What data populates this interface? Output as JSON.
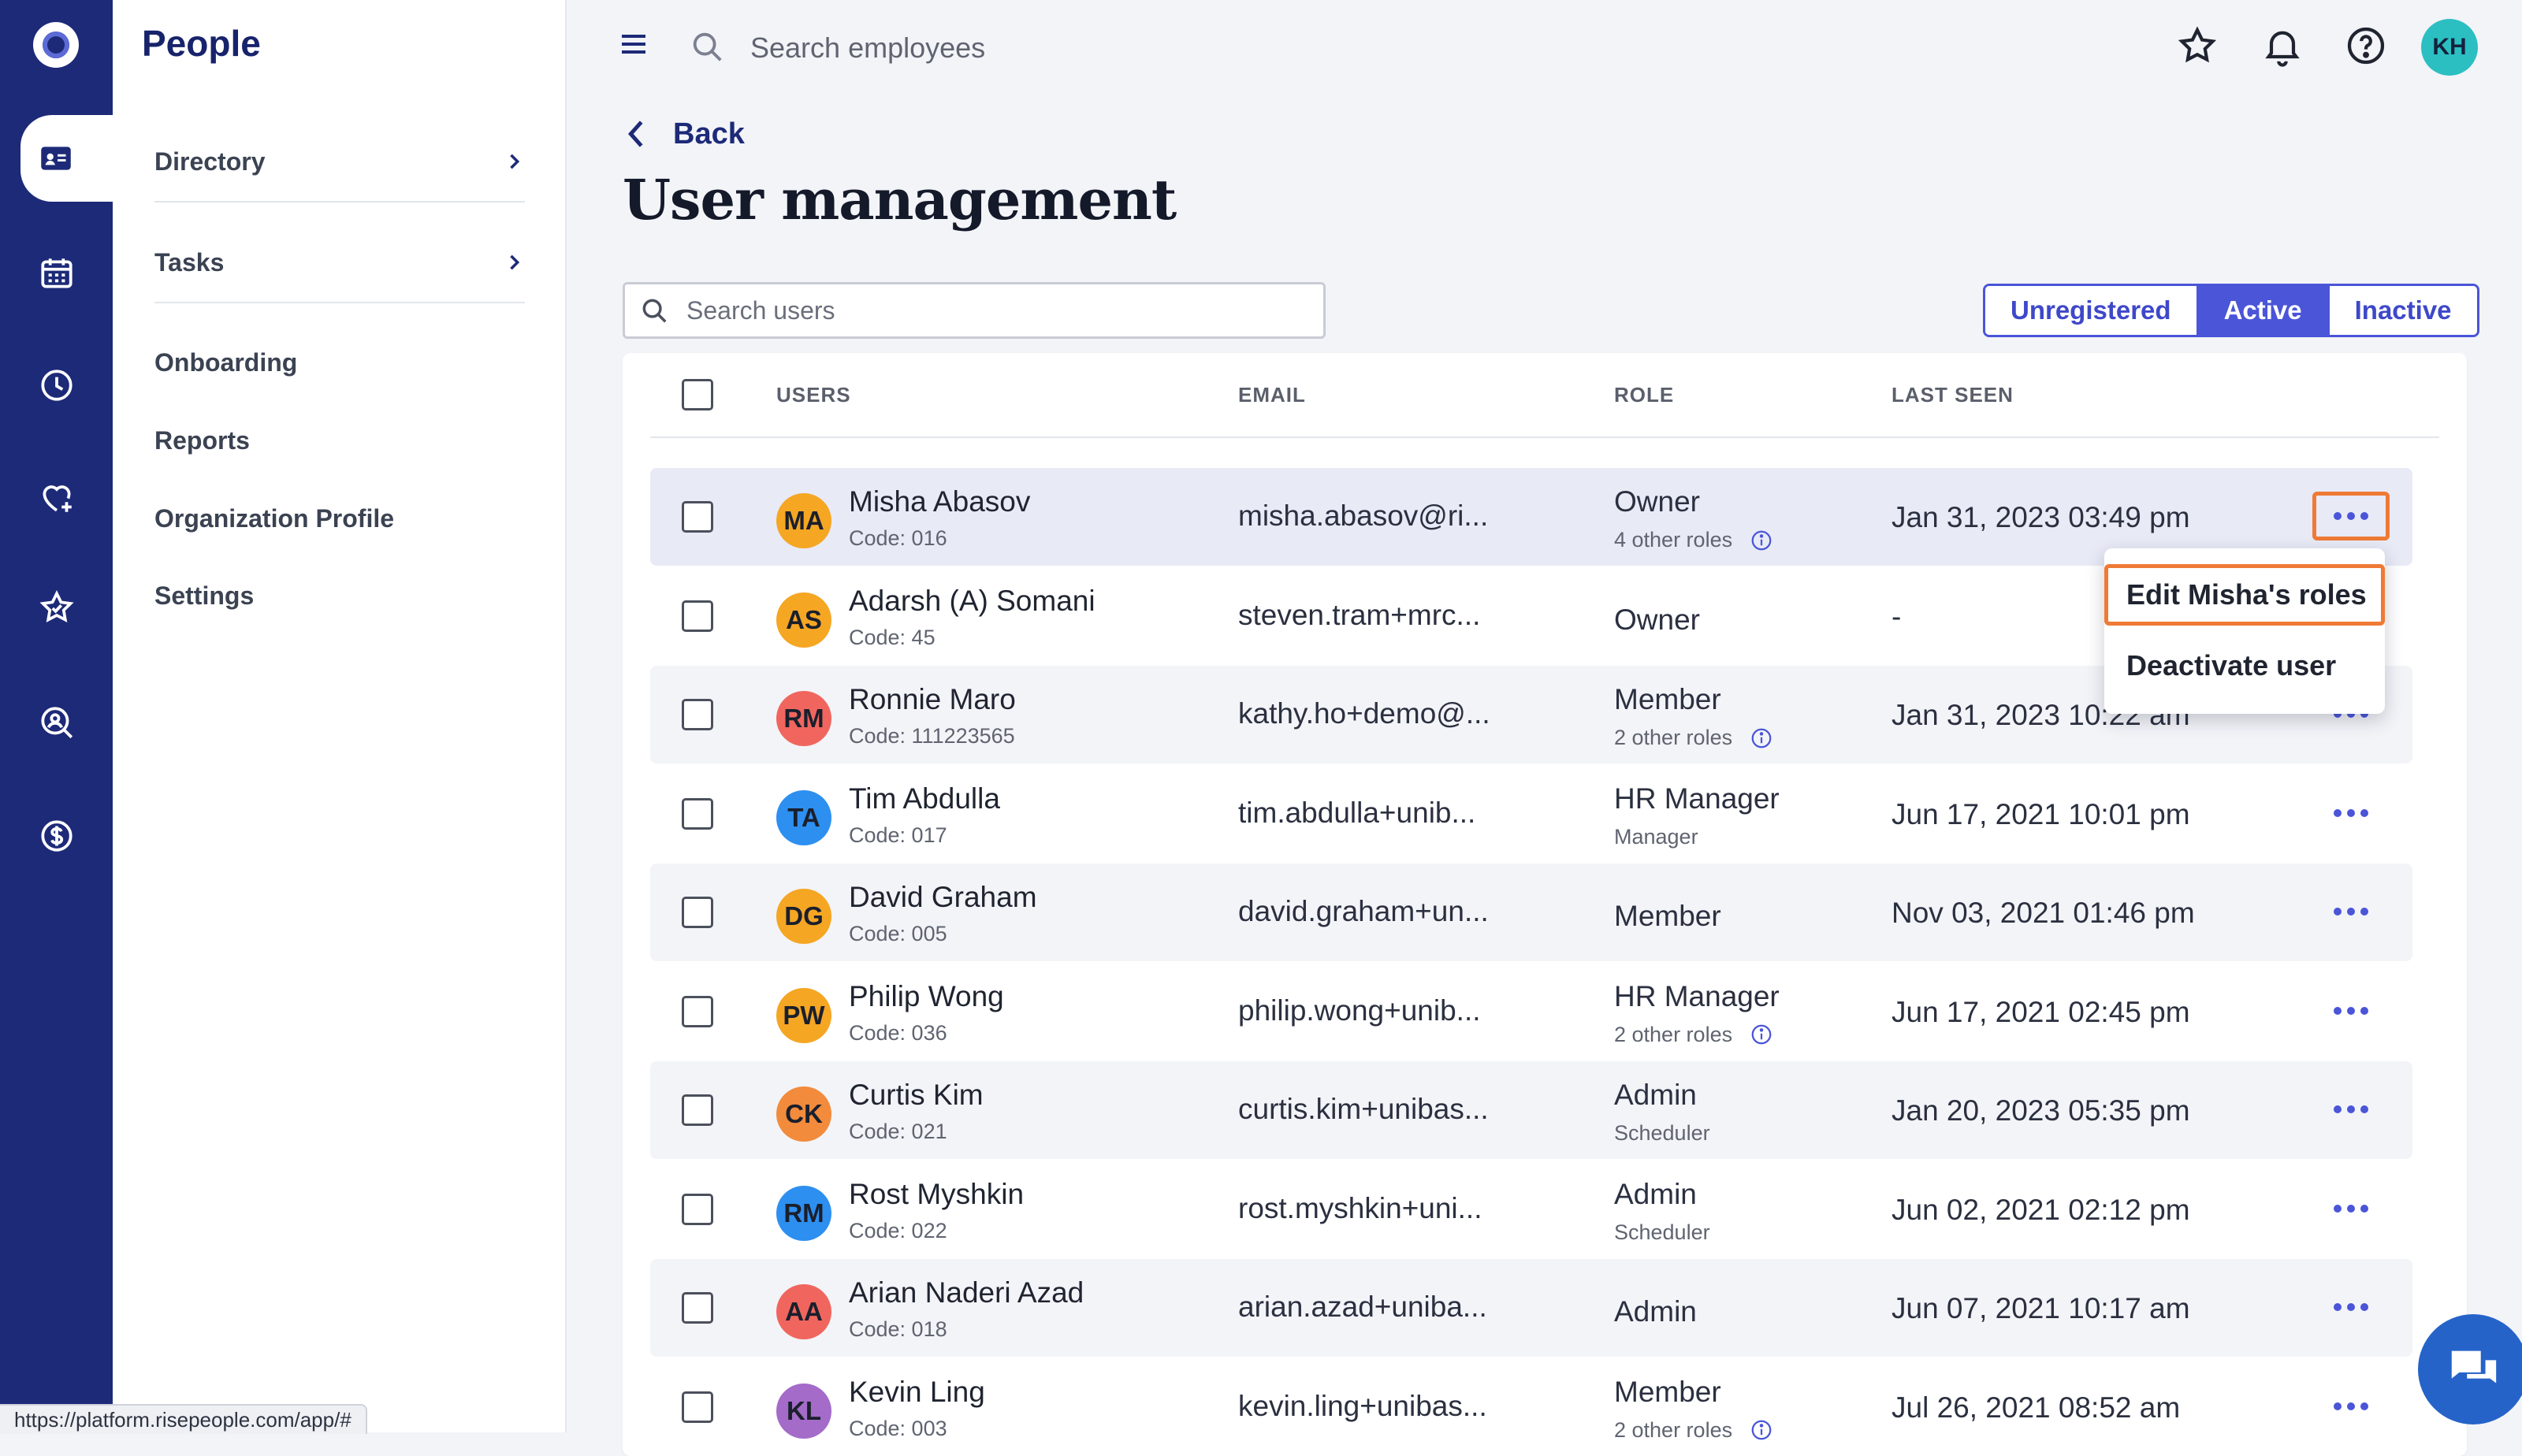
{
  "app": {
    "section_title": "People"
  },
  "subnav": {
    "items": [
      {
        "label": "Directory"
      },
      {
        "label": "Tasks"
      },
      {
        "label": "Onboarding"
      },
      {
        "label": "Reports"
      },
      {
        "label": "Organization Profile"
      },
      {
        "label": "Settings"
      }
    ]
  },
  "topbar": {
    "search_placeholder": "Search employees",
    "user_initials": "KH"
  },
  "page": {
    "back_label": "Back",
    "title": "User management",
    "search_placeholder": "Search users"
  },
  "filters": {
    "tabs": [
      {
        "label": "Unregistered"
      },
      {
        "label": "Active"
      },
      {
        "label": "Inactive"
      }
    ],
    "selected": "Active"
  },
  "table": {
    "headers": {
      "users": "USERS",
      "email": "EMAIL",
      "role": "ROLE",
      "last_seen": "LAST SEEN"
    },
    "rows": [
      {
        "initials": "MA",
        "avatar_color": "#f5a623",
        "name": "Misha Abasov",
        "code": "Code: 016",
        "email": "misha.abasov@ri...",
        "role": "Owner",
        "sub": "4 other roles",
        "last_seen": "Jan 31, 2023 03:49 pm"
      },
      {
        "initials": "AS",
        "avatar_color": "#f5a623",
        "name": "Adarsh (A) Somani",
        "code": "Code: 45",
        "email": "steven.tram+mrc...",
        "role": "Owner",
        "sub": "",
        "last_seen": "-"
      },
      {
        "initials": "RM",
        "avatar_color": "#f0665e",
        "name": "Ronnie Maro",
        "code": "Code: 111223565",
        "email": "kathy.ho+demo@...",
        "role": "Member",
        "sub": "2 other roles",
        "last_seen": "Jan 31, 2023 10:22 am"
      },
      {
        "initials": "TA",
        "avatar_color": "#2d8ff0",
        "name": "Tim Abdulla",
        "code": "Code: 017",
        "email": "tim.abdulla+unib...",
        "role": "HR Manager",
        "sub": "Manager",
        "last_seen": "Jun 17, 2021 10:01 pm"
      },
      {
        "initials": "DG",
        "avatar_color": "#f5a623",
        "name": "David Graham",
        "code": "Code: 005",
        "email": "david.graham+un...",
        "role": "Member",
        "sub": "",
        "last_seen": "Nov 03, 2021 01:46 pm"
      },
      {
        "initials": "PW",
        "avatar_color": "#f5a623",
        "name": "Philip Wong",
        "code": "Code: 036",
        "email": "philip.wong+unib...",
        "role": "HR Manager",
        "sub": "2 other roles",
        "last_seen": "Jun 17, 2021 02:45 pm"
      },
      {
        "initials": "CK",
        "avatar_color": "#f28b3c",
        "name": "Curtis Kim",
        "code": "Code: 021",
        "email": "curtis.kim+unibas...",
        "role": "Admin",
        "sub": "Scheduler",
        "last_seen": "Jan 20, 2023 05:35 pm"
      },
      {
        "initials": "RM",
        "avatar_color": "#2d8ff0",
        "name": "Rost Myshkin",
        "code": "Code: 022",
        "email": "rost.myshkin+uni...",
        "role": "Admin",
        "sub": "Scheduler",
        "last_seen": "Jun 02, 2021 02:12 pm"
      },
      {
        "initials": "AA",
        "avatar_color": "#f0665e",
        "name": "Arian Naderi Azad",
        "code": "Code: 018",
        "email": "arian.azad+uniba...",
        "role": "Admin",
        "sub": "",
        "last_seen": "Jun 07, 2021 10:17 am"
      },
      {
        "initials": "KL",
        "avatar_color": "#a46bc9",
        "name": "Kevin Ling",
        "code": "Code: 003",
        "email": "kevin.ling+unibas...",
        "role": "Member",
        "sub": "2 other roles",
        "last_seen": "Jul 26, 2021 08:52 am"
      }
    ]
  },
  "dropdown": {
    "items": [
      {
        "label": "Edit Misha's roles"
      },
      {
        "label": "Deactivate user"
      }
    ]
  },
  "statusbar": {
    "url": "https://platform.risepeople.com/app/#"
  },
  "colors": {
    "rail": "#1d2a78",
    "accent": "#4a55d8",
    "focus": "#ef7a35"
  }
}
